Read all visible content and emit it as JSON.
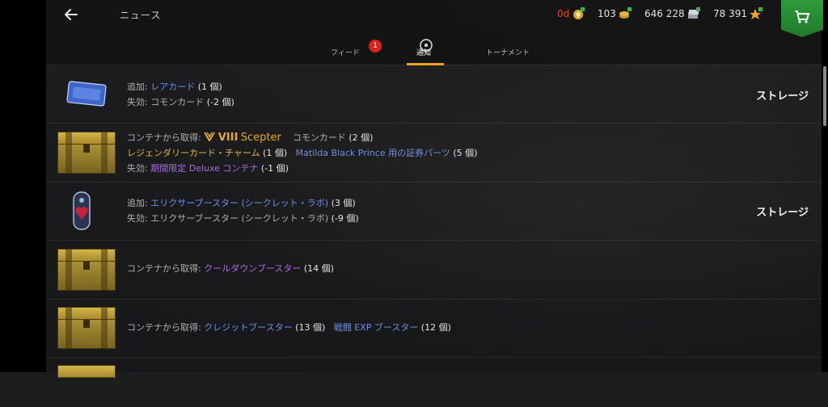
{
  "header": {
    "title": "ニュース",
    "currencies": [
      {
        "value": "0d",
        "icon": "premium-gold-icon"
      },
      {
        "value": "103",
        "icon": "gold-coins-icon"
      },
      {
        "value": "646 228",
        "icon": "silver-credits-icon"
      },
      {
        "value": "78 391",
        "icon": "free-xp-star-icon"
      }
    ],
    "store_icon": "shopping-cart-icon"
  },
  "tabs": [
    {
      "label": "フィード",
      "badge": "1"
    },
    {
      "label": "通知"
    },
    {
      "label": "トーナメント"
    }
  ],
  "colors": {
    "accent": "#f0a020",
    "blue_item": "#6f8fe8",
    "gold_item": "#e2b340",
    "purple_item": "#a76ee6",
    "badge": "#e0201c"
  },
  "rows": [
    {
      "icon": "rare-card-icon",
      "line1_label": "追加: ",
      "line1_item": "レアカード",
      "line1_count": " (1 個)",
      "line2_label": "失効: コモンカード",
      "line2_count": " (-2 個)",
      "action": "ストレージ"
    },
    {
      "icon": "container-chest-icon",
      "line1_label": "コンテナから取得: ",
      "line1_tier": "VIII",
      "line1_tank": "Scepter",
      "line1_extra": "コモンカード",
      "line1_extra_count": " (2 個)",
      "line2_item": "レジェンダリーカード・チャーム",
      "line2_count": " (1 個)",
      "line2_item2": "Matilda Black Prince 用の証券パーツ",
      "line2_count2": " (5 個)",
      "line3_label": "失効: ",
      "line3_item": "期間限定 Deluxe コンテナ",
      "line3_count": " (-1 個)"
    },
    {
      "icon": "elixir-booster-icon",
      "line1_label": "追加: ",
      "line1_item": "エリクサーブースター (シークレット・ラボ)",
      "line1_count": " (3 個)",
      "line2_label": "失効: エリクサーブースター (シークレット・ラボ)",
      "line2_count": " (-9 個)",
      "action": "ストレージ"
    },
    {
      "icon": "container-chest-icon",
      "line1_label": "コンテナから取得: ",
      "line1_item": "クールダウンブースター",
      "line1_count": " (14 個)"
    },
    {
      "icon": "container-chest-icon",
      "line1_label": "コンテナから取得: ",
      "line1_item": "クレジットブースター",
      "line1_count": " (13 個)",
      "line1_item2": "戦闘 EXP ブースター",
      "line1_count2": " (12 個)"
    }
  ]
}
